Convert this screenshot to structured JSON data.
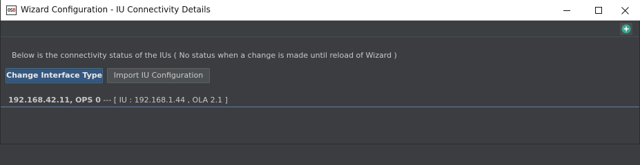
{
  "window": {
    "title": "Wizard Configuration - IU Connectivity Details",
    "app_icon_text_a": "OS",
    "app_icon_text_b": "B"
  },
  "toolbar": {
    "add_icon": "plus-circle-icon",
    "add_icon_color": "#3aa68f"
  },
  "content": {
    "info_text": "Below is the connectivity status of the IUs   ( No status when a change is made until reload of Wizard )",
    "change_interface_button": "Change Interface Type",
    "import_button": "Import IU Configuration",
    "status": {
      "host": "192.168.42.11, OPS 0",
      "detail": " --- [ IU : 192.168.1.44 , OLA 2.1 ]"
    }
  },
  "colors": {
    "background": "#3b3d40",
    "primary_button": "#365880",
    "divider": "#6a7fa6"
  }
}
